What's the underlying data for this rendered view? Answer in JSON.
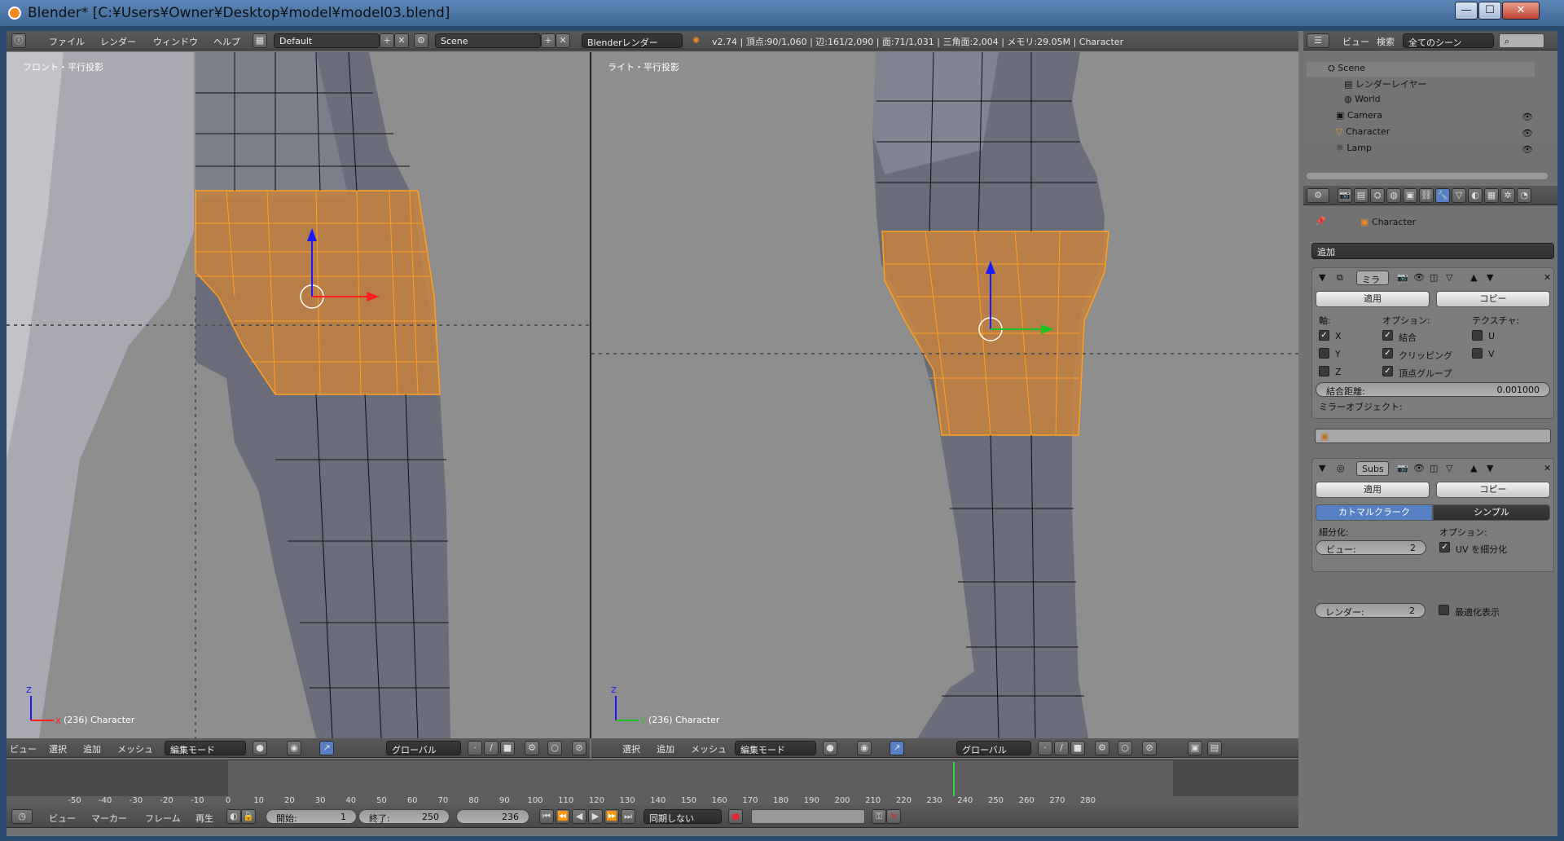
{
  "window": {
    "title": "Blender* [C:¥Users¥Owner¥Desktop¥model¥model03.blend]",
    "min": "—",
    "max": "☐",
    "close": "✕"
  },
  "info_header": {
    "menus": [
      "ファイル",
      "レンダー",
      "ウィンドウ",
      "ヘルプ"
    ],
    "layout": "Default",
    "scene": "Scene",
    "engine": "Blenderレンダー",
    "stats": "v2.74 | 頂点:90/1,060 | 辺:161/2,090 | 面:71/1,031 | 三角面:2,004 | メモリ:29.05M | Character"
  },
  "viewport_left": {
    "label": "フロント・平行投影",
    "footer": "(236) Character",
    "axis_up": "Z",
    "axis_side": "X"
  },
  "viewport_right": {
    "label": "ライト・平行投影",
    "footer": "(236) Character",
    "axis_up": "Z",
    "axis_side": "Y"
  },
  "view3d_header_left": {
    "menus": [
      "ビュー",
      "選択",
      "追加",
      "メッシュ"
    ],
    "mode": "編集モード",
    "orientation": "グローバル"
  },
  "view3d_header_right": {
    "menus": [
      "選択",
      "追加",
      "メッシュ"
    ],
    "mode": "編集モード",
    "orientation": "グローバル"
  },
  "timeline": {
    "ticks": [
      "-50",
      "-40",
      "-30",
      "-20",
      "-10",
      "0",
      "10",
      "20",
      "30",
      "40",
      "50",
      "60",
      "70",
      "80",
      "90",
      "100",
      "110",
      "120",
      "130",
      "140",
      "150",
      "160",
      "170",
      "180",
      "190",
      "200",
      "210",
      "220",
      "230",
      "240",
      "250",
      "260",
      "270",
      "280"
    ],
    "current_frame_marker": 236
  },
  "timeline_header": {
    "menus": [
      "ビュー",
      "マーカー",
      "フレーム",
      "再生"
    ],
    "start_label": "開始:",
    "start_value": "1",
    "end_label": "終了:",
    "end_value": "250",
    "current": "236",
    "sync": "同期しない"
  },
  "outliner": {
    "menus": [
      "ビュー",
      "検索"
    ],
    "filter": "全てのシーン",
    "items": [
      "Scene",
      "レンダーレイヤー",
      "World",
      "Camera",
      "Character",
      "Lamp"
    ]
  },
  "properties": {
    "context_object": "Character",
    "add_modifier": "追加",
    "mirror": {
      "name": "ミラ",
      "apply": "適用",
      "copy": "コピー",
      "axis_header": "軸:",
      "options_header": "オプション:",
      "texture_header": "テクスチャ:",
      "axis": [
        "X",
        "Y",
        "Z"
      ],
      "axis_checked": [
        true,
        false,
        false
      ],
      "options": [
        "結合",
        "クリッピング",
        "頂点グループ"
      ],
      "options_checked": [
        true,
        true,
        true
      ],
      "texture": [
        "U",
        "V"
      ],
      "texture_checked": [
        false,
        false
      ],
      "merge_label": "結合距離:",
      "merge_value": "0.001000",
      "mirror_object_label": "ミラーオブジェクト:"
    },
    "subsurf": {
      "name": "Subs",
      "apply": "適用",
      "copy": "コピー",
      "tab_catmull": "カトマルクラーク",
      "tab_simple": "シンプル",
      "subdiv_header": "細分化:",
      "options_header": "オプション:",
      "view_label": "ビュー:",
      "view_value": "2",
      "render_label": "レンダー:",
      "render_value": "2",
      "uv_label": "UV を細分化",
      "uv_checked": true,
      "opt_label": "最適化表示",
      "opt_checked": false
    }
  }
}
